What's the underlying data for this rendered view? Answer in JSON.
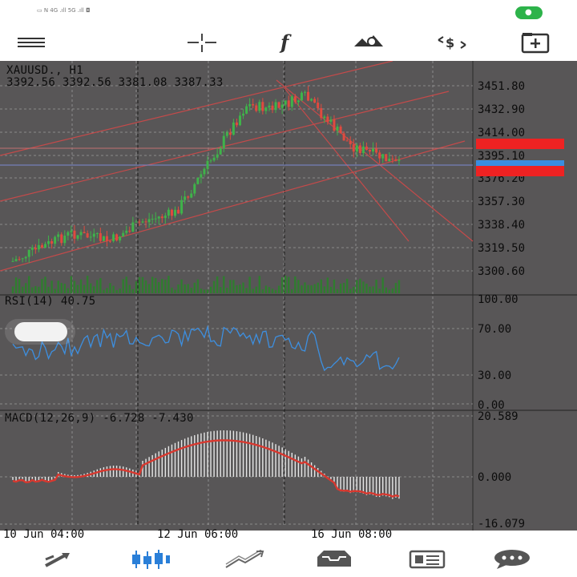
{
  "status_bar": {
    "left_text": "▭ N 4G .ıll 5G .ıll ◘"
  },
  "toolbar": {
    "icons": [
      "menu-icon",
      "crosshair-icon",
      "indicators-icon",
      "objects-icon",
      "trade-icon",
      "new-order-icon"
    ]
  },
  "chart": {
    "symbol_label": "XAUUSD., H1",
    "ohlc_label": "3392.56 3392.56 3381.08 3387.33",
    "price_axis": [
      "3451.80",
      "3432.90",
      "3414.00",
      "3395.10",
      "3376.20",
      "3357.30",
      "3338.40",
      "3319.50",
      "3300.60"
    ],
    "rsi_label": "RSI(14) 40.75",
    "rsi_axis": [
      "100.00",
      "70.00",
      "30.00",
      "0.00"
    ],
    "macd_label": "MACD(12,26,9) -6.728 -7.430",
    "macd_axis": [
      "20.589",
      "0.000",
      "-16.079"
    ],
    "time_axis": [
      "10 Jun 04:00",
      "12 Jun 06:00",
      "16 Jun 08:00"
    ],
    "colors": {
      "background": "#585657",
      "bull": "#3fb34a",
      "bear": "#e04a3f",
      "rsi_line": "#3d8fe0",
      "macd_signal": "#d8382f",
      "trendline": "#c44a4a"
    }
  },
  "bottom_nav": {
    "icons": [
      "quotes-icon",
      "chart-icon",
      "trade-icon",
      "history-icon",
      "news-icon",
      "messages-icon"
    ]
  }
}
